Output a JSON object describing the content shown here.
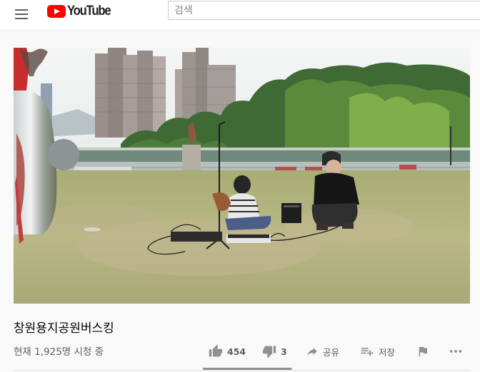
{
  "header": {
    "logo_text": "YouTube",
    "search_placeholder": "검색"
  },
  "video": {
    "title": "창원용지공원버스킹",
    "views": "현재 1,925명 시청 중"
  },
  "actions": {
    "like_count": "454",
    "dislike_count": "3",
    "share_label": "공유",
    "save_label": "저장"
  },
  "sentiment": {
    "like_fraction": 0.993
  },
  "icons": [
    "menu-icon",
    "youtube-logo-icon",
    "thumbs-up-icon",
    "thumbs-down-icon",
    "share-icon",
    "playlist-add-icon",
    "flag-icon",
    "more-horiz-icon"
  ],
  "colors": {
    "brand": "#ff0000",
    "icon": "#909090",
    "text_secondary": "#606060"
  }
}
